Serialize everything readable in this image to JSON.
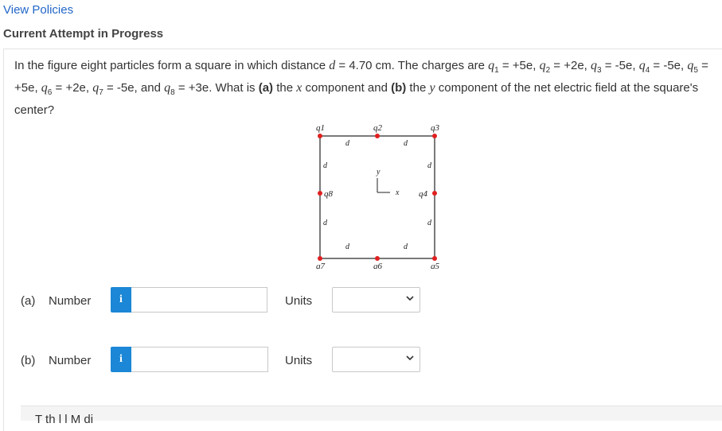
{
  "header": {
    "view_policies": "View Policies",
    "attempt_status": "Current Attempt in Progress"
  },
  "question": {
    "intro": "In the figure eight particles form a square in which distance ",
    "d_var": "d",
    "d_value": " = 4.70 cm. The charges are ",
    "q_var": "q",
    "q1_sub": "1",
    "q1_val": " = +5e, ",
    "q2_sub": "2",
    "q2_val": " = +2e, ",
    "q3_sub": "3",
    "q3_val": " = -5e, ",
    "q4_sub": "4",
    "q4_val": " = -5e, ",
    "q5_sub": "5",
    "q5_val": " = +5e, ",
    "q6_sub": "6",
    "q6_val": " = +2e, ",
    "q7_sub": "7",
    "q7_val": " = -5e, and ",
    "q8_sub": "8",
    "q8_val": " = +3e. What is ",
    "part_a": "(a)",
    "mid1": " the ",
    "x_var": "x",
    "mid2": " component and ",
    "part_b": "(b)",
    "mid3": " the ",
    "y_var": "y",
    "tail": " component of the net electric field at the square's center?"
  },
  "figure": {
    "charges": [
      "q1",
      "q2",
      "q3",
      "q4",
      "q5",
      "q6",
      "q7",
      "q8"
    ],
    "charge_color": "#e02020",
    "distance_label": "d",
    "axis_x": "x",
    "axis_y": "y"
  },
  "answers": [
    {
      "label": "(a)",
      "field": "Number",
      "info": "i",
      "value": "",
      "units_label": "Units",
      "units_value": "",
      "chevron": "⌄"
    },
    {
      "label": "(b)",
      "field": "Number",
      "info": "i",
      "value": "",
      "units_label": "Units",
      "units_value": "",
      "chevron": "⌄"
    }
  ],
  "bottom": {
    "text": "T    th    l    l M  di"
  },
  "colors": {
    "link": "#2266c8",
    "info_button": "#1b87d6"
  }
}
